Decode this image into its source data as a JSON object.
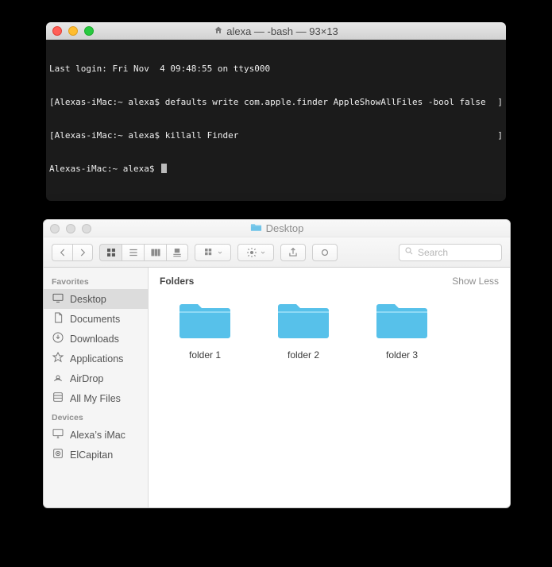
{
  "terminal": {
    "title": "alexa — -bash — 93×13",
    "lines": [
      {
        "left": "Last login: Fri Nov  4 09:48:55 on ttys000",
        "right": ""
      },
      {
        "left": "[Alexas-iMac:~ alexa$ defaults write com.apple.finder AppleShowAllFiles -bool false",
        "right": "]"
      },
      {
        "left": "[Alexas-iMac:~ alexa$ killall Finder",
        "right": "]"
      },
      {
        "left": "Alexas-iMac:~ alexa$ ",
        "right": ""
      }
    ]
  },
  "finder": {
    "title": "Desktop",
    "search_placeholder": "Search",
    "sidebar": {
      "favorites_label": "Favorites",
      "devices_label": "Devices",
      "favorites": [
        {
          "name": "desktop",
          "label": "Desktop",
          "selected": true
        },
        {
          "name": "documents",
          "label": "Documents",
          "selected": false
        },
        {
          "name": "downloads",
          "label": "Downloads",
          "selected": false
        },
        {
          "name": "applications",
          "label": "Applications",
          "selected": false
        },
        {
          "name": "airdrop",
          "label": "AirDrop",
          "selected": false
        },
        {
          "name": "allmyfiles",
          "label": "All My Files",
          "selected": false
        }
      ],
      "devices": [
        {
          "name": "device-imac",
          "label": "Alexa’s iMac"
        },
        {
          "name": "device-disk",
          "label": "ElCapitan"
        }
      ]
    },
    "content": {
      "section_title": "Folders",
      "section_action": "Show Less",
      "folders": [
        {
          "label": "folder 1"
        },
        {
          "label": "folder 2"
        },
        {
          "label": "folder 3"
        }
      ]
    }
  }
}
